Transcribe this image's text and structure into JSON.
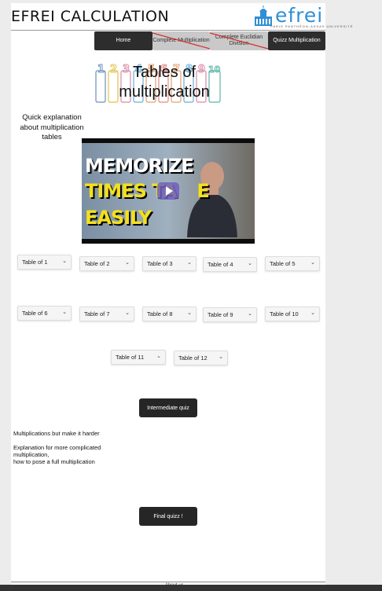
{
  "header": {
    "title": "EFREI CALCULATION",
    "logo_text": "efrei",
    "logo_subtext": "PARIS PANTHÉON-ASSAS UNIVERSITÉ"
  },
  "nav": {
    "home": "Home",
    "complete_multiplication": "Complete Multiplication",
    "complete_euclidian_division": "Complete Euclidian Division",
    "quizz_multiplication": "Quizz Multiplication"
  },
  "banner": {
    "title": "Tables of multiplication",
    "digits": [
      "1",
      "2",
      "3",
      "4",
      "5",
      "6",
      "7",
      "8",
      "9",
      "10"
    ]
  },
  "quick_explanation": "Quick explanation about multiplication tables",
  "video": {
    "line1": "MEMORIZE",
    "line2": "TIMES TA",
    "line2b": "E",
    "line3": "EASILY"
  },
  "tables": [
    "Table of 1",
    "Table of 2",
    "Table of 3",
    "Table of 4",
    "Table of 5",
    "Table of 6",
    "Table of 7",
    "Table of 8",
    "Table of 9",
    "Table of 10",
    "Table of 11",
    "Table of 12"
  ],
  "intermediate_quiz": "Intermediate quiz",
  "harder": {
    "heading": "Multiplications but make it harder",
    "line1": "Explanation for more complicated",
    "line2": "multiplication,",
    "line3": "how to pose a full multiplication"
  },
  "final_quiz": "Final quizz !",
  "footer": {
    "about": "About us"
  },
  "colors": {
    "accent": "#2f8fd6",
    "dark_button": "#2d2d2d",
    "strike": "#d92b2b"
  }
}
